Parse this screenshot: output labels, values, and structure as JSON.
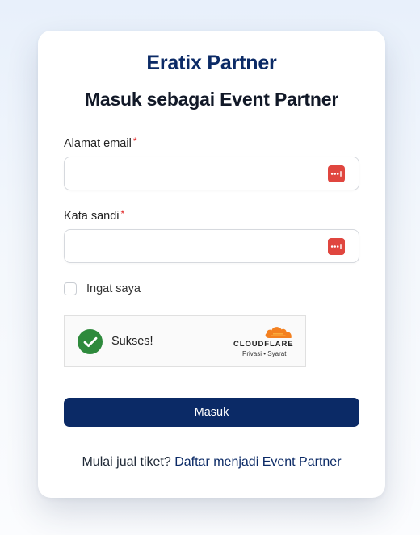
{
  "brand": "Eratix Partner",
  "title": "Masuk sebagai Event Partner",
  "form": {
    "email_label": "Alamat email",
    "email_value": "",
    "password_label": "Kata sandi",
    "password_value": "",
    "required_mark": "*",
    "remember_label": "Ingat saya",
    "remember_checked": false,
    "submit_label": "Masuk"
  },
  "captcha": {
    "status": "Sukses!",
    "provider": "CLOUDFLARE",
    "privacy_link": "Privasi",
    "separator": "•",
    "terms_link": "Syarat"
  },
  "footer": {
    "prompt": "Mulai jual tiket?",
    "link": "Daftar menjadi Event Partner"
  },
  "colors": {
    "brand_navy": "#0b2a66",
    "required_red": "#e02424",
    "password_manager_icon": "#e0463f",
    "success_green": "#2e8a3c",
    "cloudflare_orange": "#f38020"
  }
}
